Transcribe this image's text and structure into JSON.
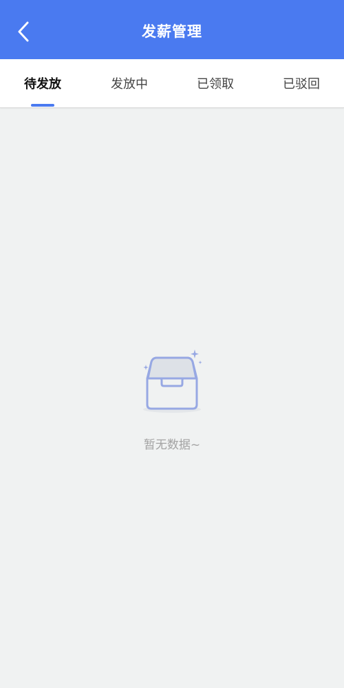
{
  "header": {
    "title": "发薪管理",
    "back_icon": "chevron-left-icon"
  },
  "tabs": [
    {
      "label": "待发放",
      "active": true
    },
    {
      "label": "发放中",
      "active": false
    },
    {
      "label": "已领取",
      "active": false
    },
    {
      "label": "已驳回",
      "active": false
    }
  ],
  "empty_state": {
    "icon": "empty-inbox-icon",
    "text": "暂无数据~"
  },
  "colors": {
    "accent": "#4a7af0",
    "background": "#f0f2f2",
    "empty_text": "#a3a3a3"
  }
}
